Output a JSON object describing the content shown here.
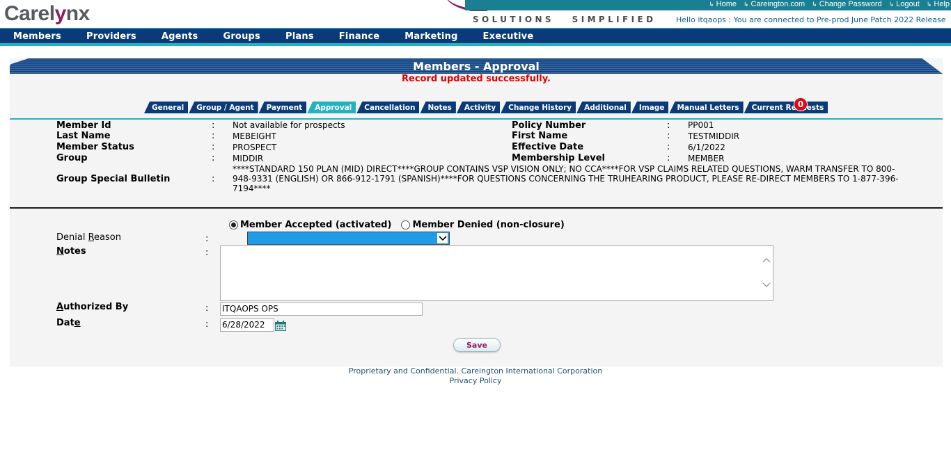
{
  "header": {
    "logo_prefix": "Care",
    "logo_mark": "l",
    "logo_x": "y",
    "logo_suffix": "nx",
    "tagline": "SOLUTIONS   SIMPLIFIED",
    "links": [
      {
        "label": "Home"
      },
      {
        "label": "Careington.com"
      },
      {
        "label": "Change Password"
      },
      {
        "label": "Logout"
      },
      {
        "label": "Help"
      }
    ],
    "link_icon": "arrow-right-icon",
    "greeting": "Hello itqaops : You are connected to Pre-prod June Patch 2022 Release"
  },
  "nav": {
    "items": [
      "Members",
      "Providers",
      "Agents",
      "Groups",
      "Plans",
      "Finance",
      "Marketing",
      "Executive"
    ]
  },
  "page": {
    "title": "Members - Approval",
    "status_message": "Record updated successfully."
  },
  "tabs": {
    "items": [
      "General",
      "Group / Agent",
      "Payment",
      "Approval",
      "Cancellation",
      "Notes",
      "Activity",
      "Change History",
      "Additional",
      "Image",
      "Manual Letters",
      "Current Requests"
    ],
    "active": "Approval",
    "requests_count": "0"
  },
  "member": {
    "member_id_label": "Member Id",
    "member_id": "Not available for prospects",
    "last_name_label": "Last Name",
    "last_name": "MEBEIGHT",
    "status_label": "Member Status",
    "status": "PROSPECT",
    "group_label": "Group",
    "group": "MIDDIR",
    "bulletin_label": "Group Special Bulletin",
    "bulletin": "****STANDARD 150 PLAN (MID) DIRECT****GROUP CONTAINS VSP VISION ONLY; NO CCA****FOR VSP CLAIMS RELATED QUESTIONS, WARM TRANSFER TO 800-948-9331 (ENGLISH) OR 866-912-1791 (SPANISH)****FOR QUESTIONS CONCERNING THE TRUHEARING PRODUCT, PLEASE RE-DIRECT MEMBERS TO 1-877-396-7194****",
    "policy_label": "Policy Number",
    "policy": "PP001",
    "first_name_label": "First Name",
    "first_name": "TESTMIDDIR",
    "effective_label": "Effective Date",
    "effective": "6/1/2022",
    "level_label": "Membership Level",
    "level": "MEMBER",
    "colon": ":"
  },
  "form": {
    "accepted_label": "Member Accepted (activated)",
    "denied_label": "Member Denied (non-closure)",
    "selected_option": "accepted",
    "denial_reason_label_pre": "Denial ",
    "denial_reason_label_u": "R",
    "denial_reason_label_post": "eason",
    "denial_reason_value": "",
    "notes_label_u": "N",
    "notes_label_post": "otes",
    "notes_value": "",
    "authorized_label_u": "A",
    "authorized_label_post": "uthorized By",
    "authorized_value": "ITQAOPS OPS",
    "date_label_pre": "Dat",
    "date_label_u": "e",
    "date_value": "6/28/2022",
    "save_label": "Save"
  },
  "footer": {
    "line1": "Proprietary and Confidential. Careington International Corporation",
    "line2": "Privacy Policy"
  },
  "colors": {
    "brand_purple": "#8d1d5e",
    "nav_blue": "#0a3b78",
    "accent_teal": "#22b2c2",
    "error_red": "#e00000",
    "badge_red": "#e30613",
    "select_blue": "#1f9be8"
  }
}
